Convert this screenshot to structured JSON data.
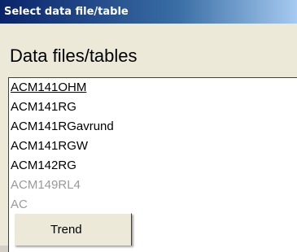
{
  "window": {
    "title": "Select data file/table"
  },
  "main": {
    "header": "Data files/tables",
    "list_items": [
      "ACM141OHM",
      "ACM141RG",
      "ACM141RGavrund",
      "ACM141RGW",
      "ACM142RG",
      "ACM149RL4",
      "AC"
    ]
  },
  "context_menu": {
    "items": [
      "Trend"
    ]
  }
}
